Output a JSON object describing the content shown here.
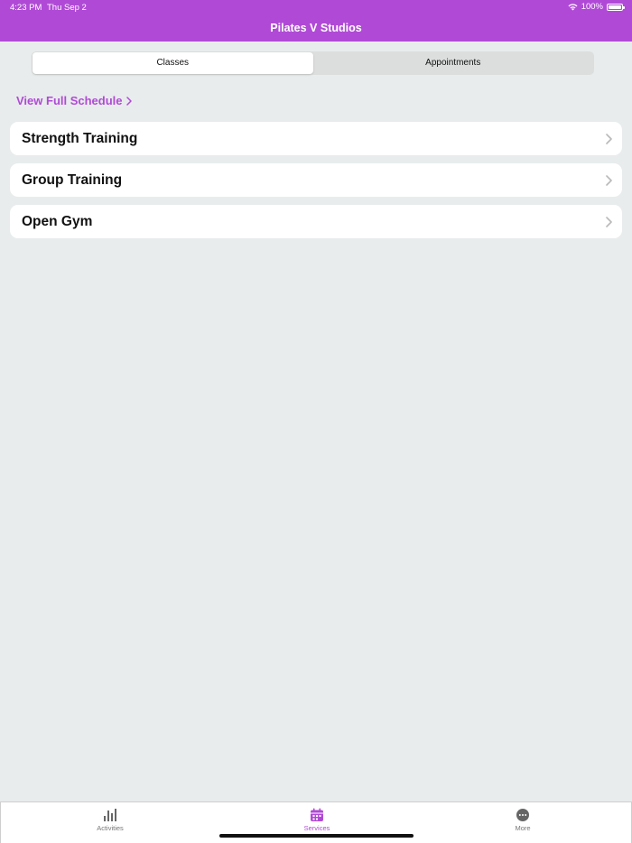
{
  "status_bar": {
    "time": "4:23 PM",
    "date": "Thu Sep 2",
    "battery": "100%"
  },
  "header": {
    "title": "Pilates V Studios"
  },
  "segmented": {
    "tabs": [
      {
        "label": "Classes",
        "active": true
      },
      {
        "label": "Appointments",
        "active": false
      }
    ]
  },
  "schedule_link": {
    "label": "View Full Schedule"
  },
  "classes": {
    "items": [
      {
        "label": "Strength Training"
      },
      {
        "label": "Group Training"
      },
      {
        "label": "Open Gym"
      }
    ]
  },
  "tabbar": {
    "tabs": [
      {
        "label": "Activities",
        "icon": "bar-chart-icon",
        "active": false
      },
      {
        "label": "Services",
        "icon": "calendar-icon",
        "active": true
      },
      {
        "label": "More",
        "icon": "more-icon",
        "active": false
      }
    ]
  },
  "colors": {
    "accent": "#b04ad6",
    "background": "#e8ecec"
  }
}
